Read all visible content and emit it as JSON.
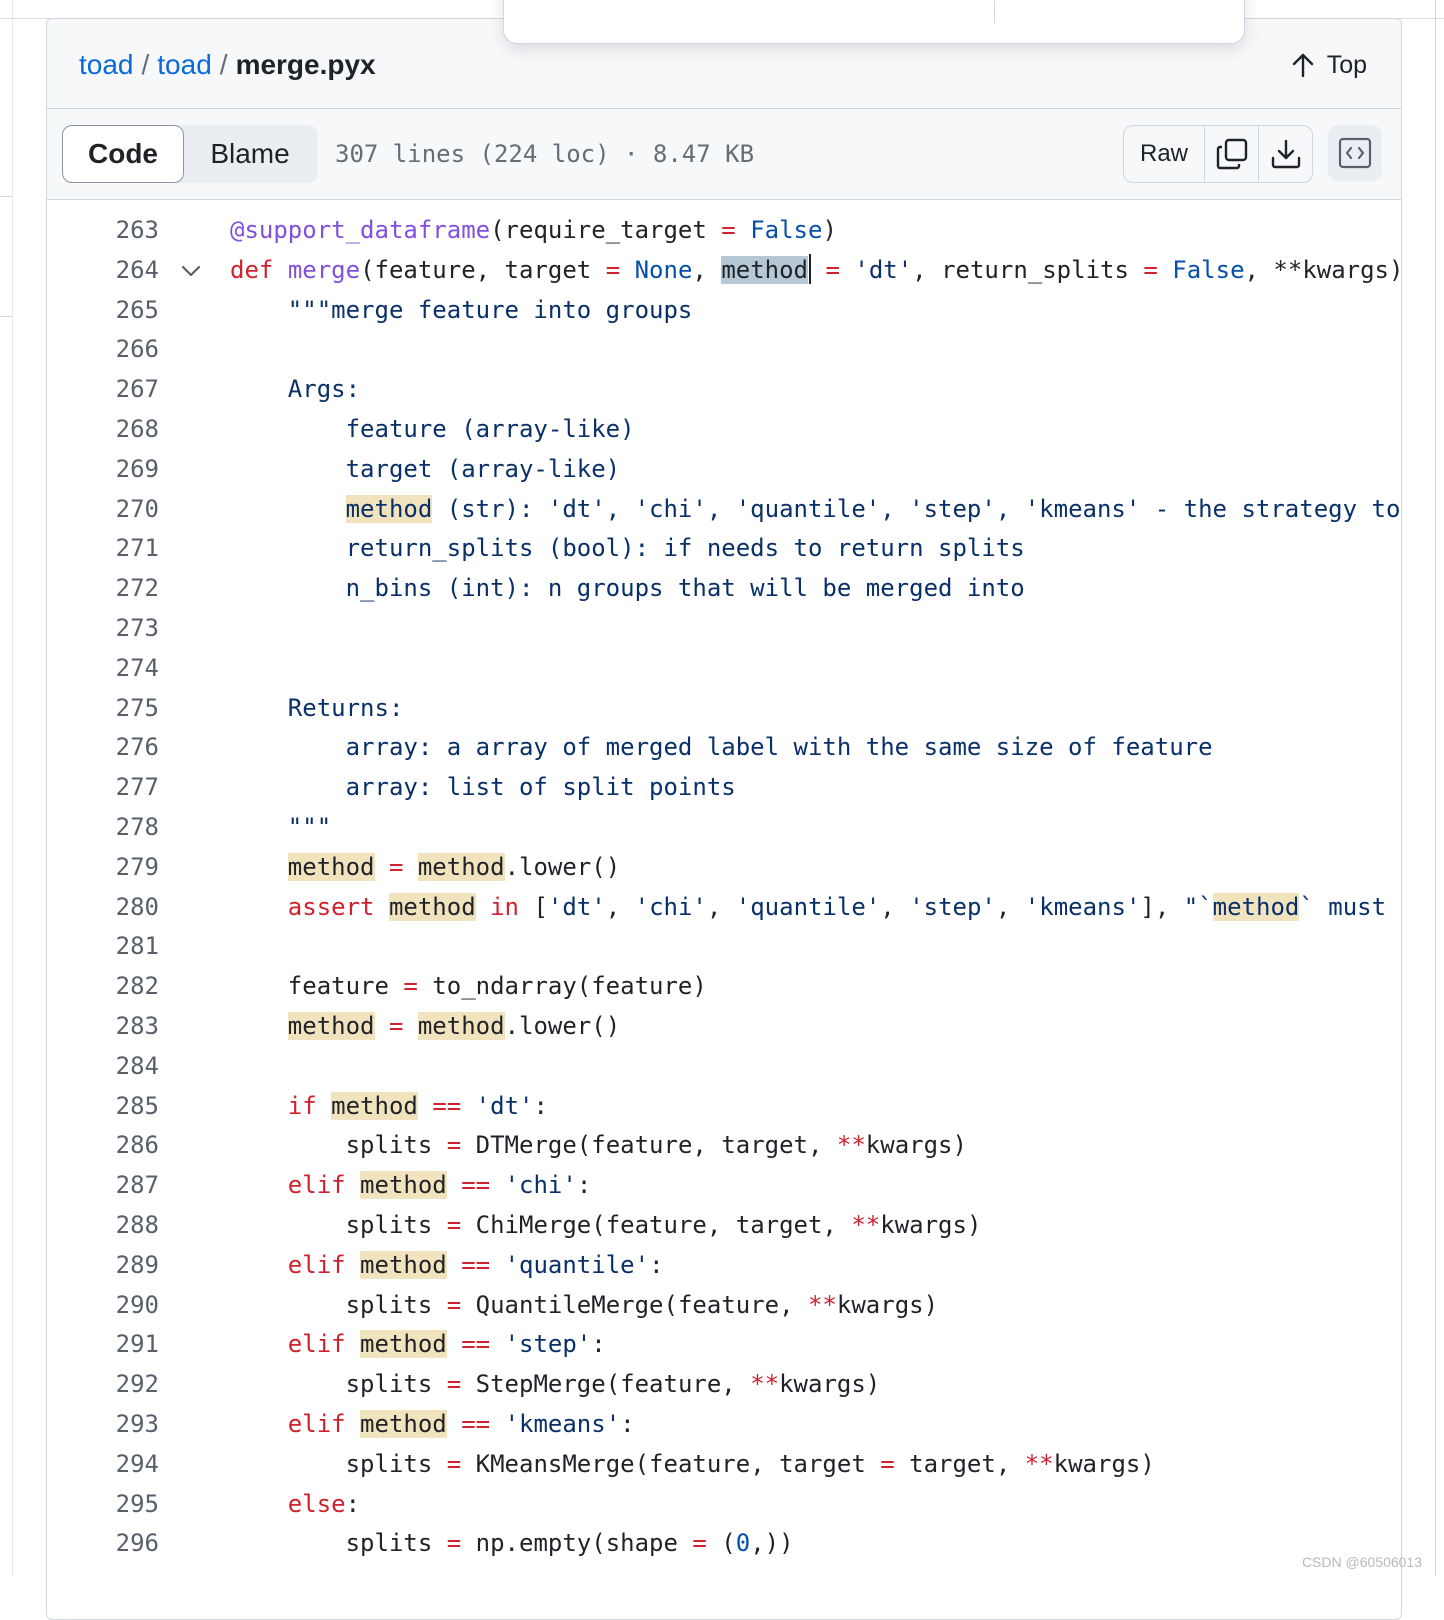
{
  "breadcrumb": {
    "repo": "toad",
    "folder": "toad",
    "sep": "/",
    "file": "merge.pyx"
  },
  "top_label": "Top",
  "toolbar": {
    "code_tab": "Code",
    "blame_tab": "Blame",
    "file_info": "307 lines (224 loc) · 8.47 KB",
    "raw_label": "Raw"
  },
  "icons": [
    "arrow-up-icon",
    "copy-icon",
    "download-icon",
    "symbols-icon",
    "chevron-down-icon"
  ],
  "colors": {
    "link": "#0969da",
    "keyword": "#cf222e",
    "constant": "#0550ae",
    "string": "#0a3069",
    "decorator": "#8250df",
    "highlight": "#f1e3be"
  },
  "code": {
    "lines": [
      {
        "n": "263",
        "parts": [
          [
            "dec",
            "@support_dataframe"
          ],
          [
            "",
            "(require_target "
          ],
          [
            "op",
            "="
          ],
          [
            "",
            " "
          ],
          [
            "con",
            "False"
          ],
          [
            "",
            ")"
          ]
        ]
      },
      {
        "n": "264",
        "fold": true,
        "parts": [
          [
            "kw",
            "def"
          ],
          [
            "",
            " "
          ],
          [
            "fn",
            "merge"
          ],
          [
            "",
            "(feature, target "
          ],
          [
            "op",
            "="
          ],
          [
            "",
            " "
          ],
          [
            "con",
            "None"
          ],
          [
            "",
            ", "
          ],
          [
            "sel",
            "method"
          ],
          [
            "caret",
            ""
          ],
          [
            "",
            " "
          ],
          [
            "op",
            "="
          ],
          [
            "",
            " "
          ],
          [
            "str",
            "'dt'"
          ],
          [
            "",
            ", return_splits "
          ],
          [
            "op",
            "="
          ],
          [
            "",
            " "
          ],
          [
            "con",
            "False"
          ],
          [
            "",
            ", **kwargs)"
          ]
        ]
      },
      {
        "n": "265",
        "parts": [
          [
            "",
            "    "
          ],
          [
            "str",
            "\"\"\"merge feature into groups"
          ]
        ]
      },
      {
        "n": "266",
        "parts": []
      },
      {
        "n": "267",
        "parts": [
          [
            "",
            "    "
          ],
          [
            "str",
            "Args:"
          ]
        ]
      },
      {
        "n": "268",
        "parts": [
          [
            "",
            "        "
          ],
          [
            "str",
            "feature (array-like)"
          ]
        ]
      },
      {
        "n": "269",
        "parts": [
          [
            "",
            "        "
          ],
          [
            "str",
            "target (array-like)"
          ]
        ]
      },
      {
        "n": "270",
        "parts": [
          [
            "",
            "        "
          ],
          [
            "hlstr",
            "method"
          ],
          [
            "str",
            " (str): 'dt', 'chi', 'quantile', 'step', 'kmeans' - the strategy to"
          ]
        ]
      },
      {
        "n": "271",
        "parts": [
          [
            "",
            "        "
          ],
          [
            "str",
            "return_splits (bool): if needs to return splits"
          ]
        ]
      },
      {
        "n": "272",
        "parts": [
          [
            "",
            "        "
          ],
          [
            "str",
            "n_bins (int): n groups that will be merged into"
          ]
        ]
      },
      {
        "n": "273",
        "parts": []
      },
      {
        "n": "274",
        "parts": []
      },
      {
        "n": "275",
        "parts": [
          [
            "",
            "    "
          ],
          [
            "str",
            "Returns:"
          ]
        ]
      },
      {
        "n": "276",
        "parts": [
          [
            "",
            "        "
          ],
          [
            "str",
            "array: a array of merged label with the same size of feature"
          ]
        ]
      },
      {
        "n": "277",
        "parts": [
          [
            "",
            "        "
          ],
          [
            "str",
            "array: list of split points"
          ]
        ]
      },
      {
        "n": "278",
        "parts": [
          [
            "",
            "    "
          ],
          [
            "str",
            "\"\"\""
          ]
        ]
      },
      {
        "n": "279",
        "parts": [
          [
            "",
            "    "
          ],
          [
            "hl",
            "method"
          ],
          [
            "",
            " "
          ],
          [
            "op",
            "="
          ],
          [
            "",
            " "
          ],
          [
            "hl",
            "method"
          ],
          [
            "",
            ".lower()"
          ]
        ]
      },
      {
        "n": "280",
        "parts": [
          [
            "",
            "    "
          ],
          [
            "kw",
            "assert"
          ],
          [
            "",
            " "
          ],
          [
            "hl",
            "method"
          ],
          [
            "",
            " "
          ],
          [
            "kw",
            "in"
          ],
          [
            "",
            " ["
          ],
          [
            "str",
            "'dt'"
          ],
          [
            "",
            ", "
          ],
          [
            "str",
            "'chi'"
          ],
          [
            "",
            ", "
          ],
          [
            "str",
            "'quantile'"
          ],
          [
            "",
            ", "
          ],
          [
            "str",
            "'step'"
          ],
          [
            "",
            ", "
          ],
          [
            "str",
            "'kmeans'"
          ],
          [
            "",
            "], "
          ],
          [
            "str",
            "\"`"
          ],
          [
            "hlstr",
            "method"
          ],
          [
            "str",
            "` must b"
          ]
        ]
      },
      {
        "n": "281",
        "parts": []
      },
      {
        "n": "282",
        "parts": [
          [
            "",
            "    feature "
          ],
          [
            "op",
            "="
          ],
          [
            "",
            " to_ndarray(feature)"
          ]
        ]
      },
      {
        "n": "283",
        "parts": [
          [
            "",
            "    "
          ],
          [
            "hl",
            "method"
          ],
          [
            "",
            " "
          ],
          [
            "op",
            "="
          ],
          [
            "",
            " "
          ],
          [
            "hl",
            "method"
          ],
          [
            "",
            ".lower()"
          ]
        ]
      },
      {
        "n": "284",
        "parts": []
      },
      {
        "n": "285",
        "parts": [
          [
            "",
            "    "
          ],
          [
            "kw",
            "if"
          ],
          [
            "",
            " "
          ],
          [
            "hl",
            "method"
          ],
          [
            "",
            " "
          ],
          [
            "op",
            "=="
          ],
          [
            "",
            " "
          ],
          [
            "str",
            "'dt'"
          ],
          [
            "",
            ":"
          ]
        ]
      },
      {
        "n": "286",
        "parts": [
          [
            "",
            "        splits "
          ],
          [
            "op",
            "="
          ],
          [
            "",
            " DTMerge(feature, target, "
          ],
          [
            "op",
            "**"
          ],
          [
            "",
            "kwargs)"
          ]
        ]
      },
      {
        "n": "287",
        "parts": [
          [
            "",
            "    "
          ],
          [
            "kw",
            "elif"
          ],
          [
            "",
            " "
          ],
          [
            "hl",
            "method"
          ],
          [
            "",
            " "
          ],
          [
            "op",
            "=="
          ],
          [
            "",
            " "
          ],
          [
            "str",
            "'chi'"
          ],
          [
            "",
            ":"
          ]
        ]
      },
      {
        "n": "288",
        "parts": [
          [
            "",
            "        splits "
          ],
          [
            "op",
            "="
          ],
          [
            "",
            " ChiMerge(feature, target, "
          ],
          [
            "op",
            "**"
          ],
          [
            "",
            "kwargs)"
          ]
        ]
      },
      {
        "n": "289",
        "parts": [
          [
            "",
            "    "
          ],
          [
            "kw",
            "elif"
          ],
          [
            "",
            " "
          ],
          [
            "hl",
            "method"
          ],
          [
            "",
            " "
          ],
          [
            "op",
            "=="
          ],
          [
            "",
            " "
          ],
          [
            "str",
            "'quantile'"
          ],
          [
            "",
            ":"
          ]
        ]
      },
      {
        "n": "290",
        "parts": [
          [
            "",
            "        splits "
          ],
          [
            "op",
            "="
          ],
          [
            "",
            " QuantileMerge(feature, "
          ],
          [
            "op",
            "**"
          ],
          [
            "",
            "kwargs)"
          ]
        ]
      },
      {
        "n": "291",
        "parts": [
          [
            "",
            "    "
          ],
          [
            "kw",
            "elif"
          ],
          [
            "",
            " "
          ],
          [
            "hl",
            "method"
          ],
          [
            "",
            " "
          ],
          [
            "op",
            "=="
          ],
          [
            "",
            " "
          ],
          [
            "str",
            "'step'"
          ],
          [
            "",
            ":"
          ]
        ]
      },
      {
        "n": "292",
        "parts": [
          [
            "",
            "        splits "
          ],
          [
            "op",
            "="
          ],
          [
            "",
            " StepMerge(feature, "
          ],
          [
            "op",
            "**"
          ],
          [
            "",
            "kwargs)"
          ]
        ]
      },
      {
        "n": "293",
        "parts": [
          [
            "",
            "    "
          ],
          [
            "kw",
            "elif"
          ],
          [
            "",
            " "
          ],
          [
            "hl",
            "method"
          ],
          [
            "",
            " "
          ],
          [
            "op",
            "=="
          ],
          [
            "",
            " "
          ],
          [
            "str",
            "'kmeans'"
          ],
          [
            "",
            ":"
          ]
        ]
      },
      {
        "n": "294",
        "parts": [
          [
            "",
            "        splits "
          ],
          [
            "op",
            "="
          ],
          [
            "",
            " KMeansMerge(feature, target "
          ],
          [
            "op",
            "="
          ],
          [
            "",
            " target, "
          ],
          [
            "op",
            "**"
          ],
          [
            "",
            "kwargs)"
          ]
        ]
      },
      {
        "n": "295",
        "parts": [
          [
            "",
            "    "
          ],
          [
            "kw",
            "else"
          ],
          [
            "",
            ":"
          ]
        ]
      },
      {
        "n": "296",
        "parts": [
          [
            "",
            "        splits "
          ],
          [
            "op",
            "="
          ],
          [
            "",
            " np.empty(shape "
          ],
          [
            "op",
            "="
          ],
          [
            "",
            " ("
          ],
          [
            "con",
            "0"
          ],
          [
            "",
            ",))"
          ]
        ]
      }
    ]
  },
  "watermark": "CSDN @60506013"
}
